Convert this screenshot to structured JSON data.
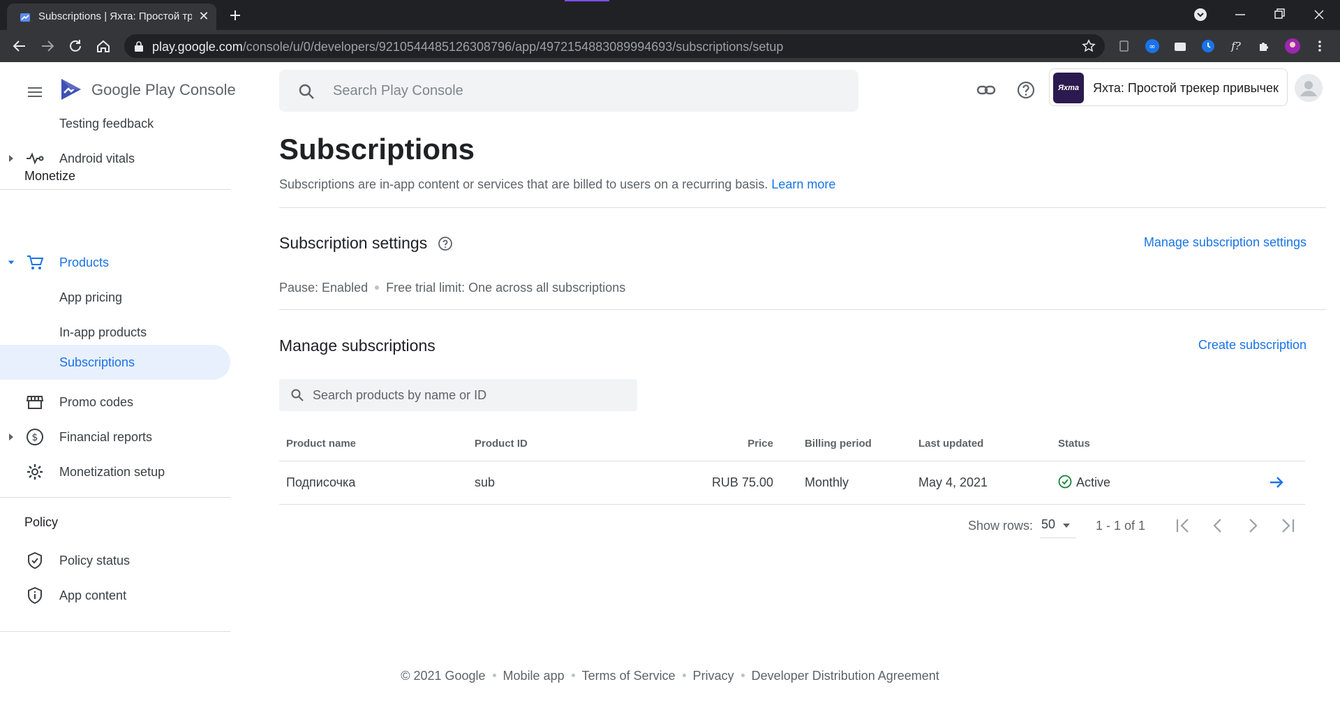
{
  "browser": {
    "tab_title": "Subscriptions | Яхта: Простой тр",
    "url_host": "play.google.com",
    "url_path": "/console/u/0/developers/9210544485126308796/app/4972154883089994693/subscriptions/setup"
  },
  "brand": {
    "name_part1": "Google Play",
    "name_part2": "Console"
  },
  "sidebar": {
    "items_top": [
      {
        "label": "Testing feedback"
      },
      {
        "label": "Android vitals"
      }
    ],
    "section_monetize": "Monetize",
    "monetize_items": [
      {
        "label": "Products"
      },
      {
        "label": "App pricing"
      },
      {
        "label": "In-app products"
      },
      {
        "label": "Subscriptions"
      },
      {
        "label": "Promo codes"
      },
      {
        "label": "Financial reports"
      },
      {
        "label": "Monetization setup"
      }
    ],
    "section_policy": "Policy",
    "policy_items": [
      {
        "label": "Policy status"
      },
      {
        "label": "App content"
      }
    ]
  },
  "topbar": {
    "search_placeholder": "Search Play Console",
    "app_name": "Яхта: Простой трекер привычек",
    "app_icon_text": "Яхта"
  },
  "page": {
    "title": "Subscriptions",
    "lead": "Subscriptions are in-app content or services that are billed to users on a recurring basis.",
    "learn_more": "Learn more",
    "settings_title": "Subscription settings",
    "manage_settings_link": "Manage subscription settings",
    "pause": "Pause: Enabled",
    "trial_limit": "Free trial limit: One across all subscriptions",
    "manage_title": "Manage subscriptions",
    "create_link": "Create subscription",
    "product_search_placeholder": "Search products by name or ID"
  },
  "table": {
    "headers": {
      "name": "Product name",
      "id": "Product ID",
      "price": "Price",
      "billing": "Billing period",
      "updated": "Last updated",
      "status": "Status"
    },
    "rows": [
      {
        "name": "Подписочка",
        "id": "sub",
        "price": "RUB 75.00",
        "billing": "Monthly",
        "updated": "May 4, 2021",
        "status": "Active"
      }
    ]
  },
  "pager": {
    "label": "Show rows:",
    "rows": "50",
    "range": "1 - 1 of 1"
  },
  "footer": {
    "copyright": "© 2021 Google",
    "links": [
      "Mobile app",
      "Terms of Service",
      "Privacy",
      "Developer Distribution Agreement"
    ]
  },
  "colors": {
    "accent": "#1a73e8",
    "success": "#188038",
    "active_bg": "#e8f0fe"
  }
}
